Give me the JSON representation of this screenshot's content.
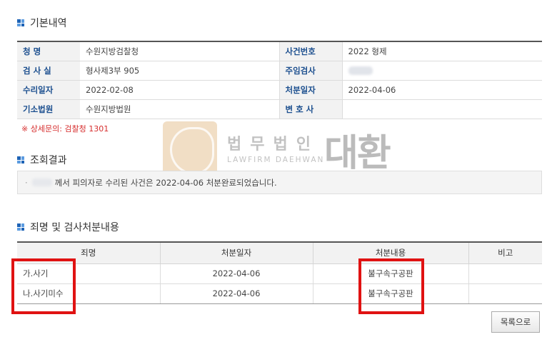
{
  "sections": {
    "basic": "기본내역",
    "result": "조회결과",
    "crime": "죄명 및 검사처분내용"
  },
  "info": {
    "rows": [
      {
        "l1": "청    명",
        "v1": "수원지방검찰청",
        "l2": "사건번호",
        "v2": "2022 형제"
      },
      {
        "l1": "검 사 실",
        "v1": "형사제3부 905",
        "l2": "주임검사",
        "v2": ""
      },
      {
        "l1": "수리일자",
        "v1": "2022-02-08",
        "l2": "처분일자",
        "v2": "2022-04-06"
      },
      {
        "l1": "기소법원",
        "v1": "수원지방법원",
        "l2": "변 호 사",
        "v2": ""
      }
    ]
  },
  "note": "※ 상세문의: 검찰청 1301",
  "watermark": {
    "kr": "법무법인",
    "en": "LAWFIRM DAEHWAN",
    "big": "대환"
  },
  "result_text": "께서 피의자로 수리된 사건은 2022-04-06 처분완료되었습니다.",
  "crime_table": {
    "headers": [
      "죄명",
      "처분일자",
      "처분내용",
      "비고"
    ],
    "rows": [
      {
        "name": "가.사기",
        "date": "2022-04-06",
        "disposition": "불구속구공판",
        "note": ""
      },
      {
        "name": "나.사기미수",
        "date": "2022-04-06",
        "disposition": "불구속구공판",
        "note": ""
      }
    ]
  },
  "list_button": "목록으로",
  "colors": {
    "highlight": "#e01212",
    "label_text": "#1c4f8f",
    "note_text": "#d62d2d"
  }
}
